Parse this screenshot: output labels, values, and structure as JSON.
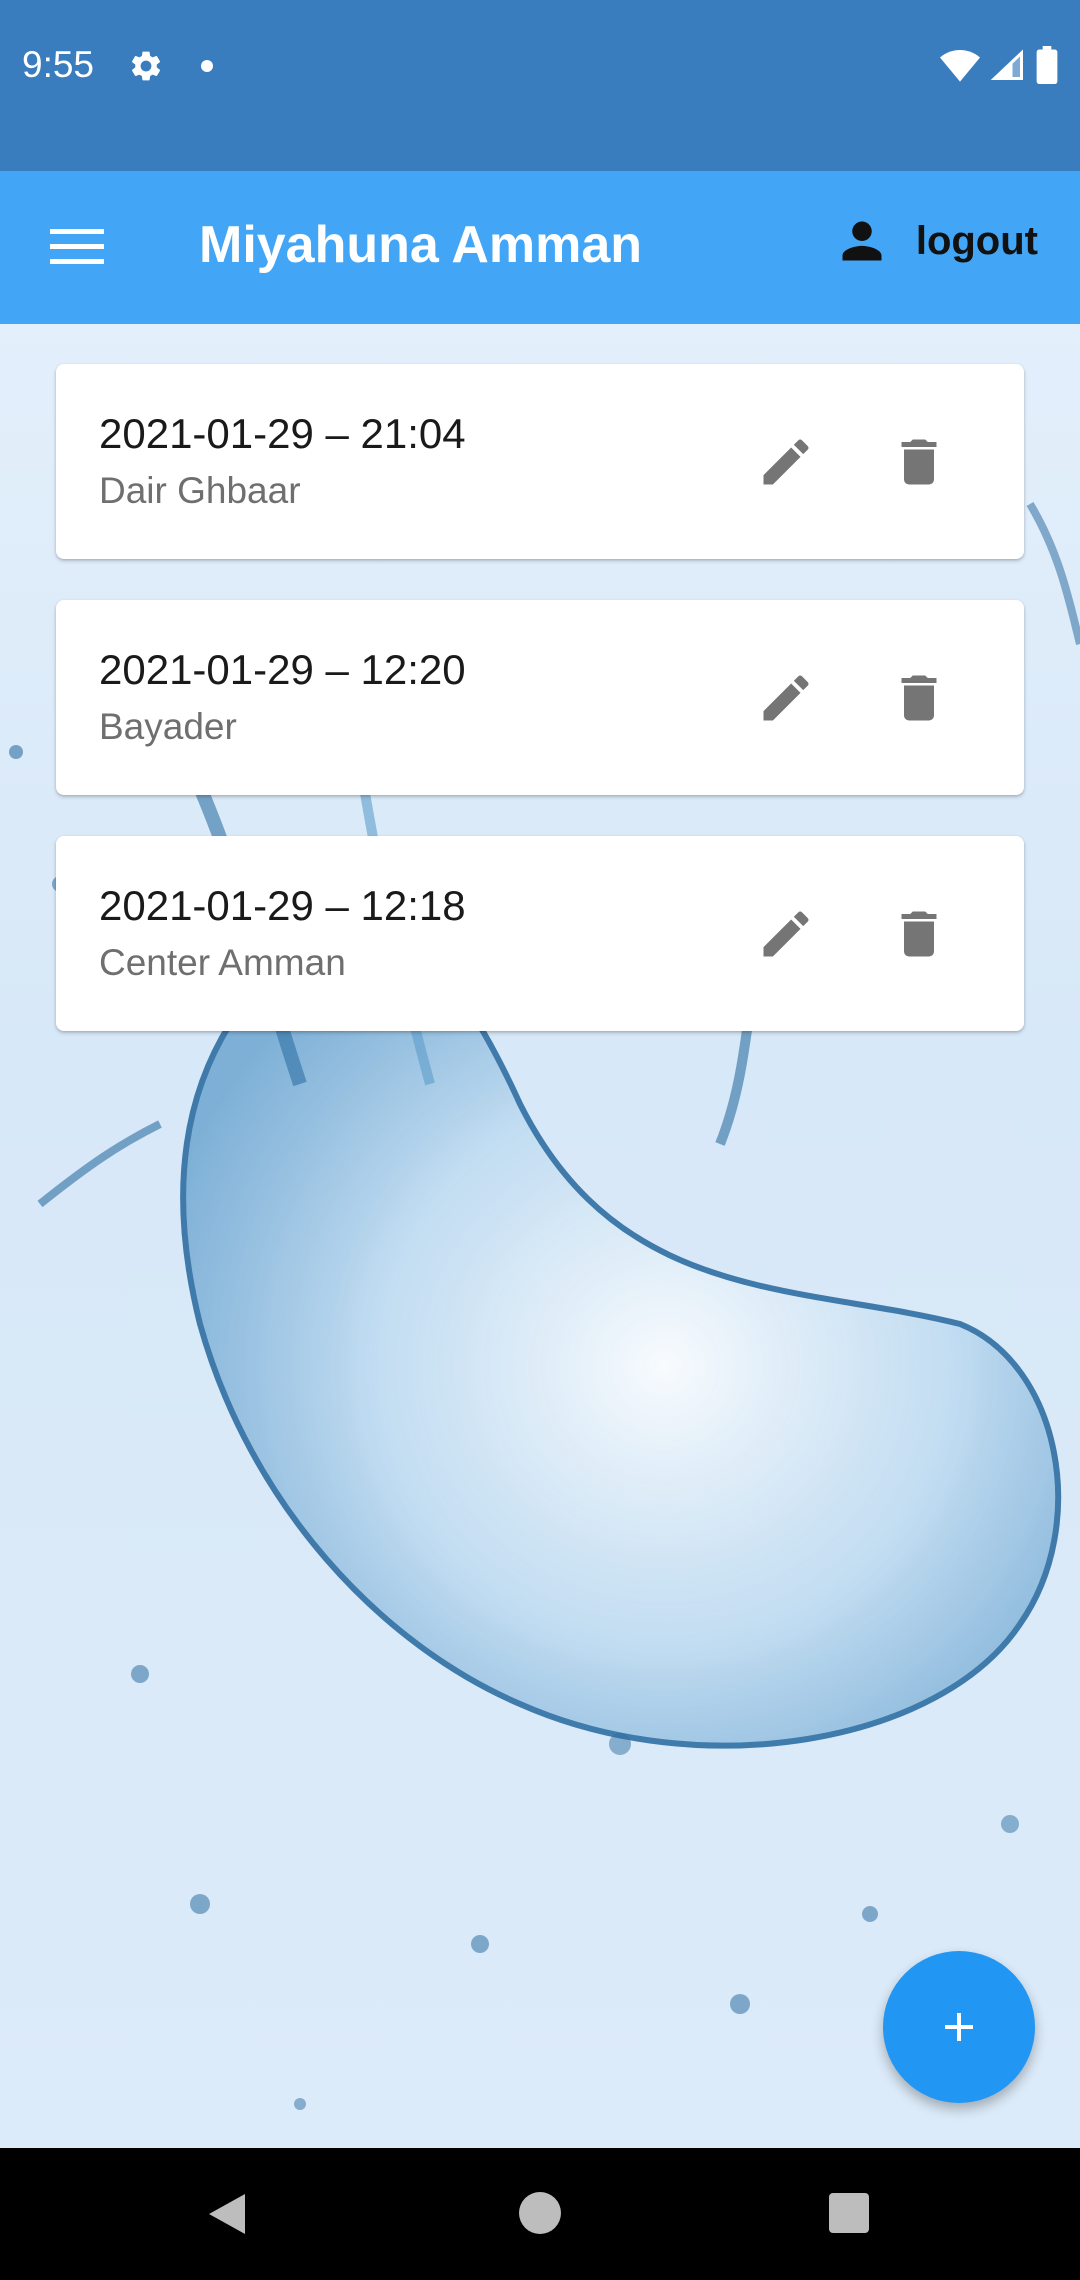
{
  "status_bar": {
    "time": "9:55",
    "icons": [
      "settings-gear-icon",
      "notification-dot-icon",
      "wifi-icon",
      "signal-icon",
      "battery-icon"
    ]
  },
  "app_bar": {
    "title": "Miyahuna Amman",
    "logout_label": "logout",
    "background": "#42a5f5"
  },
  "entries": [
    {
      "datetime": "2021-01-29 – 21:04",
      "location": "Dair Ghbaar"
    },
    {
      "datetime": "2021-01-29 – 12:20",
      "location": "Bayader"
    },
    {
      "datetime": "2021-01-29 – 12:18",
      "location": "Center Amman"
    }
  ],
  "fab": {
    "icon": "plus-icon",
    "color": "#2196f3"
  },
  "colors": {
    "status_bar": "#3a7dbe",
    "nav_bar": "#000000"
  }
}
